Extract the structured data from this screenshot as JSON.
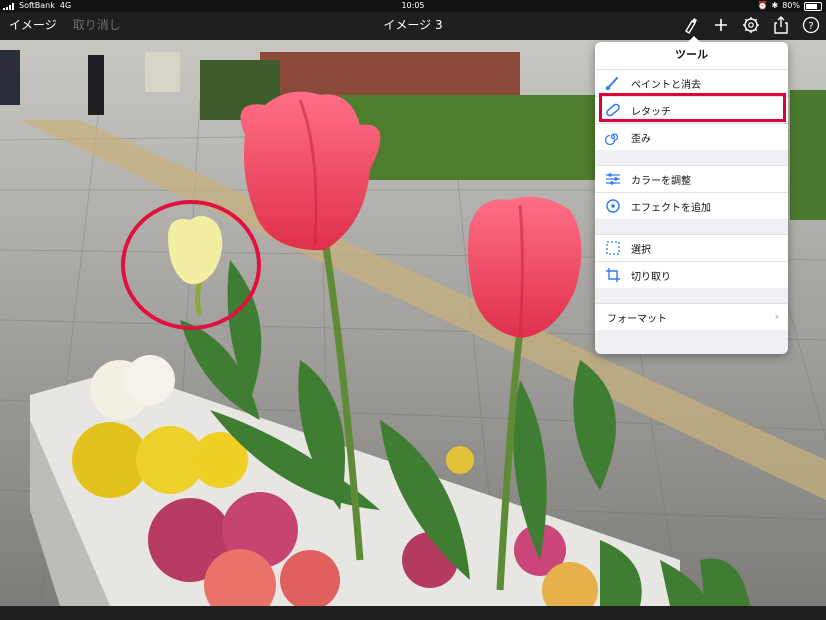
{
  "status_bar": {
    "carrier": "SoftBank",
    "network": "4G",
    "time": "10:05",
    "battery": "80%"
  },
  "nav": {
    "images_label": "イメージ",
    "undo_label": "取り消し",
    "title": "イメージ 3"
  },
  "tools_popover": {
    "title": "ツール",
    "items": [
      {
        "label": "ペイントと消去",
        "icon": "brush-icon"
      },
      {
        "label": "レタッチ",
        "icon": "bandage-icon"
      },
      {
        "label": "歪み",
        "icon": "swirl-icon"
      },
      {
        "label": "カラーを調整",
        "icon": "sliders-icon"
      },
      {
        "label": "エフェクトを追加",
        "icon": "effects-icon"
      },
      {
        "label": "選択",
        "icon": "select-icon"
      },
      {
        "label": "切り取り",
        "icon": "crop-icon"
      },
      {
        "label": "フォーマット",
        "icon": "chevron-right-icon"
      }
    ]
  },
  "colors": {
    "accent": "#2f7bf6",
    "highlight": "#e0003a"
  }
}
